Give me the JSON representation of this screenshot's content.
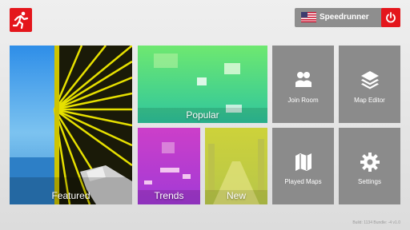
{
  "header": {
    "logo_icon": "running-man-icon",
    "user": {
      "flag_icon": "us-flag-icon",
      "name": "Speedrunner",
      "power_icon": "power-icon"
    }
  },
  "tiles": {
    "featured": "Featured",
    "popular": "Popular",
    "trends": "Trends",
    "new": "New",
    "join_room": "Join Room",
    "map_editor": "Map Editor",
    "played_maps": "Played Maps",
    "settings": "Settings"
  },
  "icons": {
    "join_room": "users-icon",
    "map_editor": "layers-icon",
    "played_maps": "map-icon",
    "settings": "gear-icon"
  },
  "footer": {
    "build": "Build: 1134    Bundle: -4    v1.0"
  },
  "colors": {
    "accent": "#e4161c",
    "tile_gray": "#8b8b8b"
  }
}
